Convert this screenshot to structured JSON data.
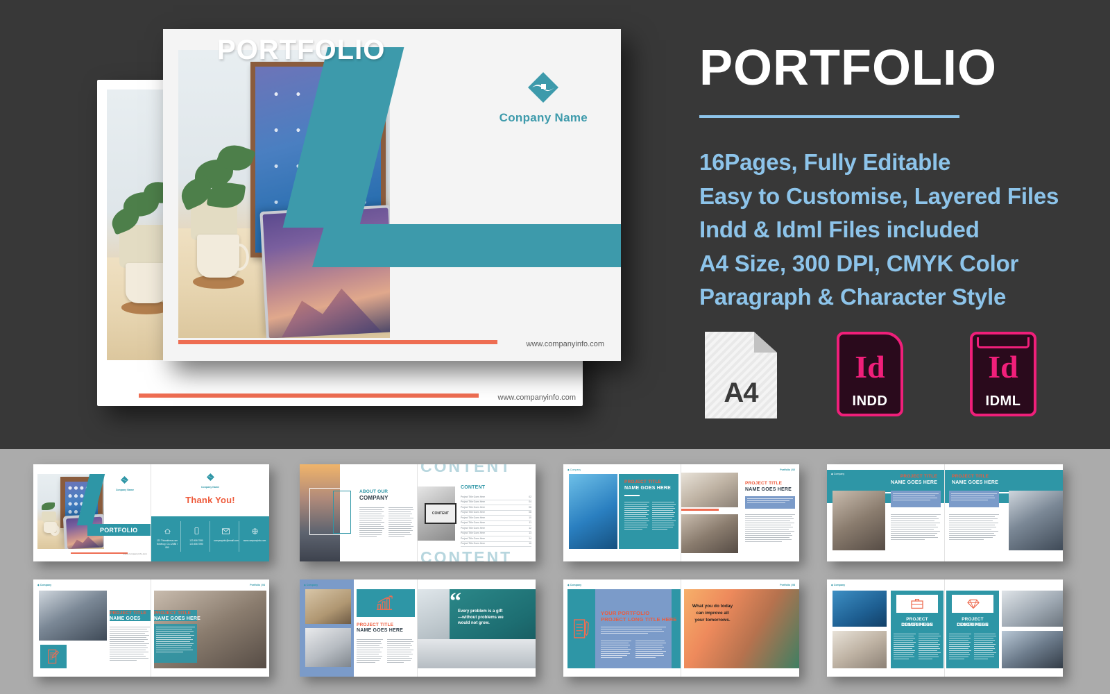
{
  "promo": {
    "title": "PORTFOLIO",
    "features": [
      "16Pages, Fully Editable",
      "Easy to Customise, Layered Files",
      "Indd & Idml Files included",
      "A4 Size, 300 DPI, CMYK Color",
      "Paragraph & Character Style"
    ],
    "accent_color": "#8dc4ea",
    "title_color": "#ffffff",
    "background_color": "#383838"
  },
  "badges": [
    {
      "id": "a4",
      "label": "A4",
      "glyph": "",
      "type": "page-size"
    },
    {
      "id": "indd",
      "label": "INDD",
      "glyph": "Id",
      "type": "adobe-indesign-file"
    },
    {
      "id": "idml",
      "label": "IDML",
      "glyph": "Id",
      "type": "adobe-indesign-markup-file"
    }
  ],
  "cover": {
    "company_name": "Conpany Name",
    "title": "PORTFOLIO",
    "url": "www.companyinfo.com",
    "teal": "#3d9aab",
    "orange": "#ee6d52"
  },
  "back_cover": {
    "url": "www.companyinfo.com"
  },
  "thumbnails": [
    {
      "id": "cover-thankyou",
      "left_page": {
        "title": "PORTFOLIO",
        "company": "Conpany Name",
        "url": "www.companyinfo.com"
      },
      "right_page": {
        "company": "Conpany Name",
        "heading": "Thank You!",
        "contacts": [
          {
            "icon": "home-icon",
            "line1": "123 Thisaddress.com",
            "line2": "Newbury, CA 12486 / 890"
          },
          {
            "icon": "phone-icon",
            "line1": "123 456 7890",
            "line2": "123 456 7890"
          },
          {
            "icon": "mail-icon",
            "line1": "companyinfo@email.com",
            "line2": ""
          },
          {
            "icon": "globe-icon",
            "line1": "www.companyinfo.com",
            "line2": ""
          }
        ]
      }
    },
    {
      "id": "about-content",
      "left_page": {
        "heading_line1": "ABOUT OUR",
        "heading_line2": "COMPANY"
      },
      "right_page": {
        "heading": "CONTENT",
        "ghost_word": "CONTENT",
        "image_label": "CONTENT",
        "toc_items": [
          {
            "label": "Project Title Goes Here",
            "page": "02"
          },
          {
            "label": "Project Title Goes Here",
            "page": "04"
          },
          {
            "label": "Project Title Goes Here",
            "page": "06"
          },
          {
            "label": "Project Title Goes Here",
            "page": "08"
          },
          {
            "label": "Project Title Goes Here",
            "page": "10"
          },
          {
            "label": "Project Title Goes Here",
            "page": "11"
          },
          {
            "label": "Project Title Goes Here",
            "page": "12"
          },
          {
            "label": "Project Title Goes Here",
            "page": "13"
          },
          {
            "label": "Project Title Goes Here",
            "page": "14"
          },
          {
            "label": "Project Title Goes Here",
            "page": "16"
          }
        ]
      }
    },
    {
      "id": "project-spread-1",
      "left_page": {
        "title": "PROJECT TITLE",
        "subtitle": "NAME GOES HERE"
      },
      "right_page": {
        "title": "PROJECT TITLE",
        "subtitle": "NAME GOES HERE"
      }
    },
    {
      "id": "project-spread-2",
      "left_page": {
        "title": "PROJECT TITLE",
        "subtitle": "NAME GOES HERE"
      },
      "right_page": {
        "title": "PROJECT TITLE",
        "subtitle": "NAME GOES HERE"
      }
    },
    {
      "id": "project-spread-3",
      "left_page": {
        "title": "PROJECT TITLE",
        "subtitle": "NAME GOES HERE",
        "icon": "document-pen-icon"
      },
      "right_page": {
        "title": "PROJECT TITLE",
        "subtitle": "NAME GOES HERE"
      }
    },
    {
      "id": "project-quote",
      "left_page": {
        "title": "PROJECT TITLE",
        "subtitle": "NAME GOES HERE",
        "icon": "bar-chart-growth-icon"
      },
      "right_page": {
        "quote": "Every problem is a gift—without problems we would not grow."
      }
    },
    {
      "id": "portfolio-long-title",
      "left_page": {
        "title_line1": "YOUR PORTFOLIO",
        "title_line2": "PROJECT LONG TITLE HERE",
        "icon": "document-pencil-icon"
      },
      "right_page": {
        "motto": "What you do today can improve all your tomorrows."
      }
    },
    {
      "id": "project-descriptions",
      "left_page": {
        "heading_line1": "PROJECT DESCRIPTION",
        "heading_line2": "COMES HERE",
        "icon": "briefcase-icon"
      },
      "right_page": {
        "heading_line1": "PROJECT DESCRIPTION",
        "heading_line2": "COMES HERE",
        "icon": "diamond-icon"
      }
    }
  ]
}
